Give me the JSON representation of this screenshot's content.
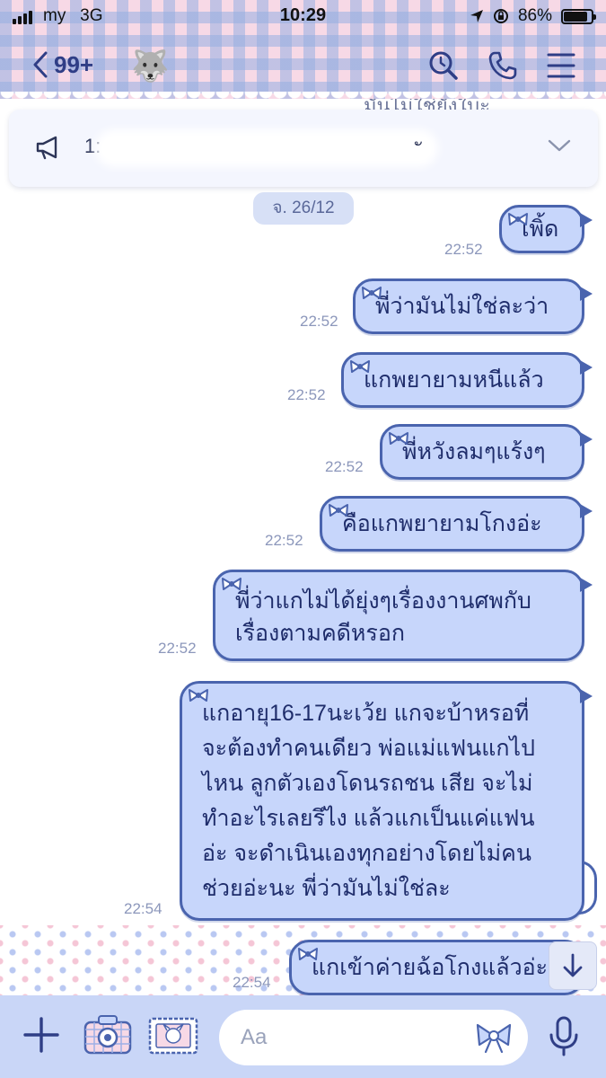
{
  "status_bar": {
    "carrier": "my",
    "network": "3G",
    "time": "10:29",
    "battery": "86%",
    "battery_level": 0.86
  },
  "header": {
    "back_count": "99+",
    "avatar_icon": "wolf-avatar",
    "icons": [
      "search-icon",
      "phone-icon",
      "menu-icon"
    ]
  },
  "announcement": {
    "visible_prefix": "1:",
    "visible_suffix": "ั"
  },
  "partial_top_text": "มันไม่ใช่ยั่งใบะ",
  "date_pill": "จ. 26/12",
  "messages": [
    {
      "text": "เพิ้ด",
      "time": "22:52"
    },
    {
      "text": "พี่ว่ามันไม่ใช่ละว่า",
      "time": "22:52"
    },
    {
      "text": "แกพยายามหนีแล้ว",
      "time": "22:52"
    },
    {
      "text": "พี่หวังลมๆแร้งๆ",
      "time": "22:52"
    },
    {
      "text": "คือแกพยายามโกงอ่ะ",
      "time": "22:52"
    },
    {
      "lines": [
        "พี่ว่าแกไม่ได้ยุ่งๆเรื่องงานศพกับ",
        "เรื่องตามคดีหรอก"
      ],
      "time": "22:52"
    },
    {
      "lines": [
        "แกอายุ16-17นะเว้ย แกจะบ้าหรอที่",
        "จะต้องทำคนเดียว พ่อแม่แฟนแกไป",
        "ไหน ลูกตัวเองโดนรถชน เสีย จะไม่",
        "ทำอะไรเลยรึไง แล้วแกเป็นแค่แฟน",
        "อ่ะ จะดำเนินเองทุกอย่างโดยไม่คน",
        "ช่วยอ่ะนะ พี่ว่ามันไม่ใช่ละ"
      ],
      "time": "22:54"
    },
    {
      "text": "แกเข้าค่ายฉ้อโกงแล้วอ่ะ",
      "time": "22:54"
    }
  ],
  "input": {
    "placeholder": "Aa"
  },
  "colors": {
    "bubble_fill": "#c7d6fb",
    "bubble_border": "#4a64ae",
    "bubble_text": "#1f2d6b",
    "timestamp": "#8c97bb",
    "input_bar": "#c9d6f7"
  }
}
